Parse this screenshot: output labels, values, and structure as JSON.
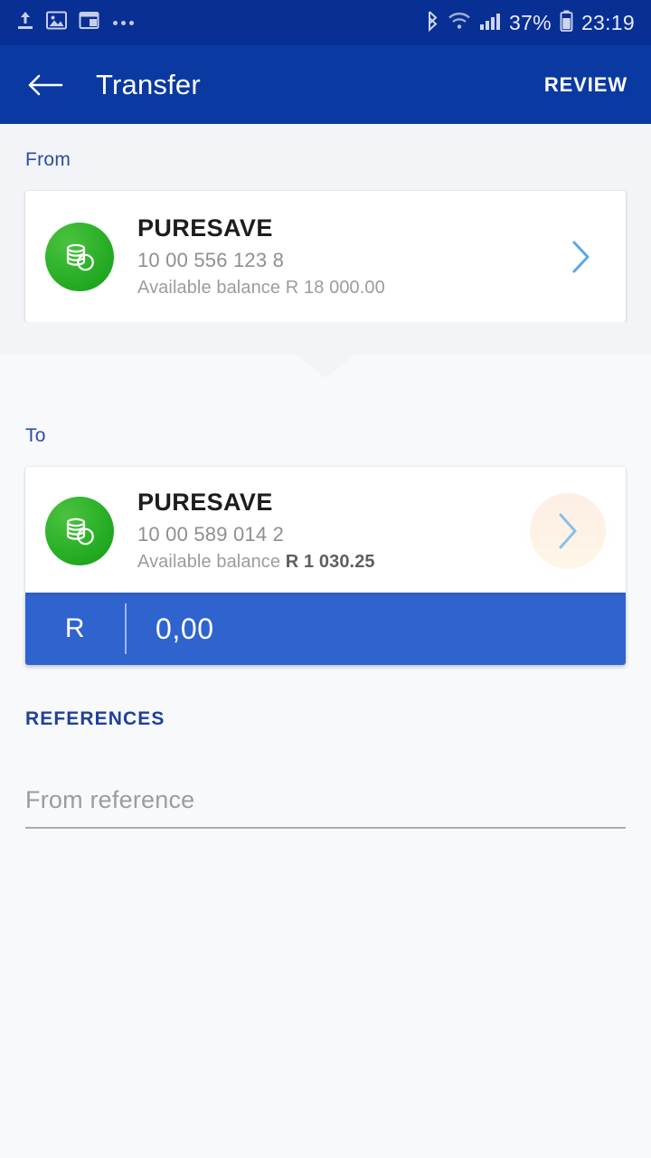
{
  "status_bar": {
    "left_icons": [
      "upload-icon",
      "image-icon",
      "window-icon",
      "overflow-dots-icon"
    ],
    "right_icons": [
      "bluetooth-icon",
      "wifi-icon",
      "cellular-signal-icon",
      "battery-icon"
    ],
    "battery_percent": "37%",
    "clock": "23:19",
    "background_color": "#082f93"
  },
  "app_bar": {
    "back_icon": "arrow-left-icon",
    "title": "Transfer",
    "action_label": "REVIEW",
    "background_color": "#0a39a2"
  },
  "from": {
    "label": "From",
    "account": {
      "icon": "savings-coins-icon",
      "name": "PURESAVE",
      "number": "10 00 556 123 8",
      "balance_label": "Available balance",
      "balance_value": "R 18 000.00",
      "chevron_icon": "chevron-right-icon",
      "icon_color": "#2fb32b"
    }
  },
  "to": {
    "label": "To",
    "account": {
      "icon": "savings-coins-icon",
      "name": "PURESAVE",
      "number": "10 00 589 014 2",
      "balance_label": "Available balance",
      "balance_value": "R 1 030.25",
      "chevron_icon": "chevron-right-icon",
      "icon_color": "#2fb32b",
      "highlight_ring_colors": [
        "#ef3b33",
        "#f89c12"
      ]
    }
  },
  "amount": {
    "currency_symbol": "R",
    "value": "0,00",
    "background_color": "#2f63ce"
  },
  "references": {
    "heading": "REFERENCES",
    "from_reference": {
      "value": "",
      "placeholder": "From reference"
    }
  },
  "colors": {
    "page_background": "#f7f9fb",
    "from_zone_background": "#f2f4f7",
    "accent_blue": "#0a39a2",
    "label_blue": "#2a4ca8",
    "chevron_blue": "#5aa8e8"
  }
}
